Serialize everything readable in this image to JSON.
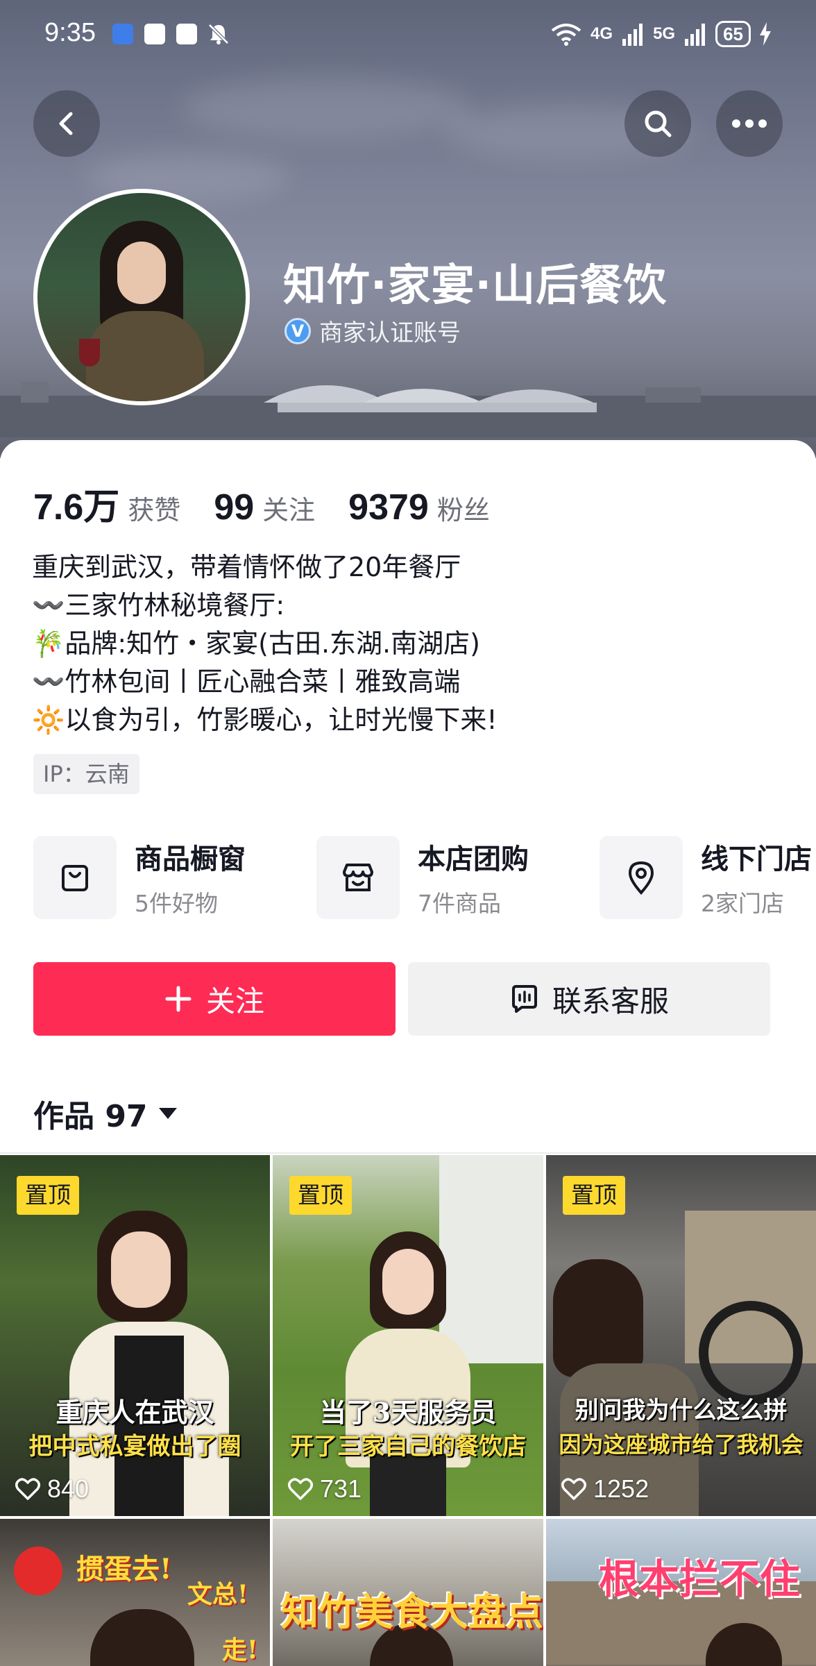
{
  "status_bar": {
    "time": "9:35",
    "network_1": "4G",
    "network_2": "5G",
    "battery": "65"
  },
  "nav": {
    "back_icon": "chevron-left-icon",
    "search_icon": "search-icon",
    "more_icon": "more-dots-icon"
  },
  "profile": {
    "name": "知竹·家宴·山后餐饮",
    "verified_label": "商家认证账号",
    "verified_badge": "V"
  },
  "stats": [
    {
      "value": "7.6万",
      "label": "获赞"
    },
    {
      "value": "99",
      "label": "关注"
    },
    {
      "value": "9379",
      "label": "粉丝"
    }
  ],
  "bio": [
    "重庆到武汉，带着情怀做了20年餐厅",
    "〰️三家竹林秘境餐厅:",
    "🎋品牌:知竹・家宴(古田.东湖.南湖店)",
    "〰️竹林包间丨匠心融合菜丨雅致高端",
    "🔆以食为引，竹影暖心，让时光慢下来!"
  ],
  "ip_location": "IP：云南",
  "services": [
    {
      "title": "商品橱窗",
      "subtitle": "5件好物",
      "icon": "shopping-bag-icon"
    },
    {
      "title": "本店团购",
      "subtitle": "7件商品",
      "icon": "store-icon"
    },
    {
      "title": "线下门店",
      "subtitle": "2家门店",
      "icon": "location-pin-icon"
    }
  ],
  "buttons": {
    "follow": "关注",
    "contact": "联系客服"
  },
  "works_tab": {
    "label": "作品 97"
  },
  "videos": [
    {
      "pinned": "置顶",
      "caption_1": "重庆人在武汉",
      "caption_2": "把中式私宴做出了圈",
      "likes": "840"
    },
    {
      "pinned": "置顶",
      "caption_1": "当了3天服务员",
      "caption_2": "开了三家自己的餐饮店",
      "likes": "731"
    },
    {
      "pinned": "置顶",
      "caption_1": "别问我为什么这么拼",
      "caption_2": "因为这座城市给了我机会",
      "likes": "1252"
    },
    {
      "caption_1": "掼蛋去!",
      "caption_2": "文总!",
      "caption_3": "走!"
    },
    {
      "caption_1": "知竹美食大盘点"
    },
    {
      "caption_1": "根本拦不住"
    }
  ],
  "colors": {
    "accent": "#fe2c55",
    "pin_badge": "#fdd92e",
    "verified": "#4c9df1"
  }
}
